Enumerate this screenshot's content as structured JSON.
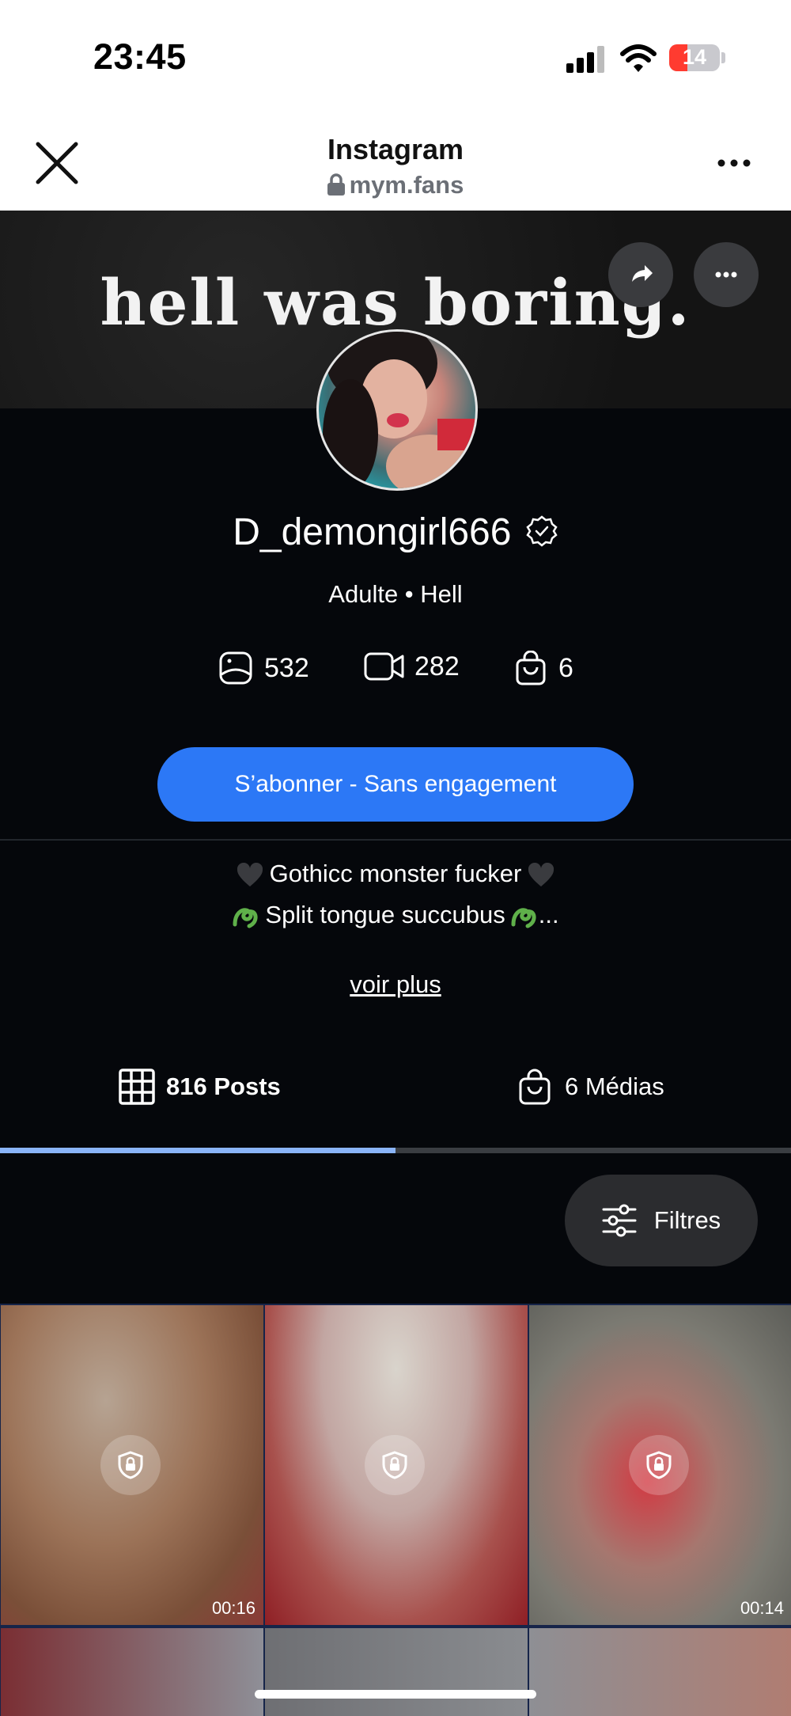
{
  "status_bar": {
    "time": "23:45",
    "battery": "14"
  },
  "browser": {
    "title": "Instagram",
    "url": "mym.fans"
  },
  "banner": {
    "text": "hell was boring."
  },
  "profile": {
    "name": "D_demongirl666",
    "subtitle": "Adulte • Hell",
    "stats": {
      "photos": "532",
      "videos": "282",
      "medias": "6"
    },
    "subscribe_label": "S’abonner - Sans engagement",
    "bio_line1": "Gothicc monster fucker",
    "bio_line2": "Split tongue succubus",
    "bio_line2_suffix": "...",
    "voir_plus": "voir plus"
  },
  "tabs": {
    "posts": "816 Posts",
    "medias": "6 Médias",
    "active": "posts"
  },
  "filters_label": "Filtres",
  "grid": [
    {
      "duration": "00:16"
    },
    {
      "duration": ""
    },
    {
      "duration": "00:14"
    }
  ],
  "colors": {
    "accent": "#2c78f6",
    "tab_indicator": "#8ab4f8",
    "background": "#05070b"
  }
}
